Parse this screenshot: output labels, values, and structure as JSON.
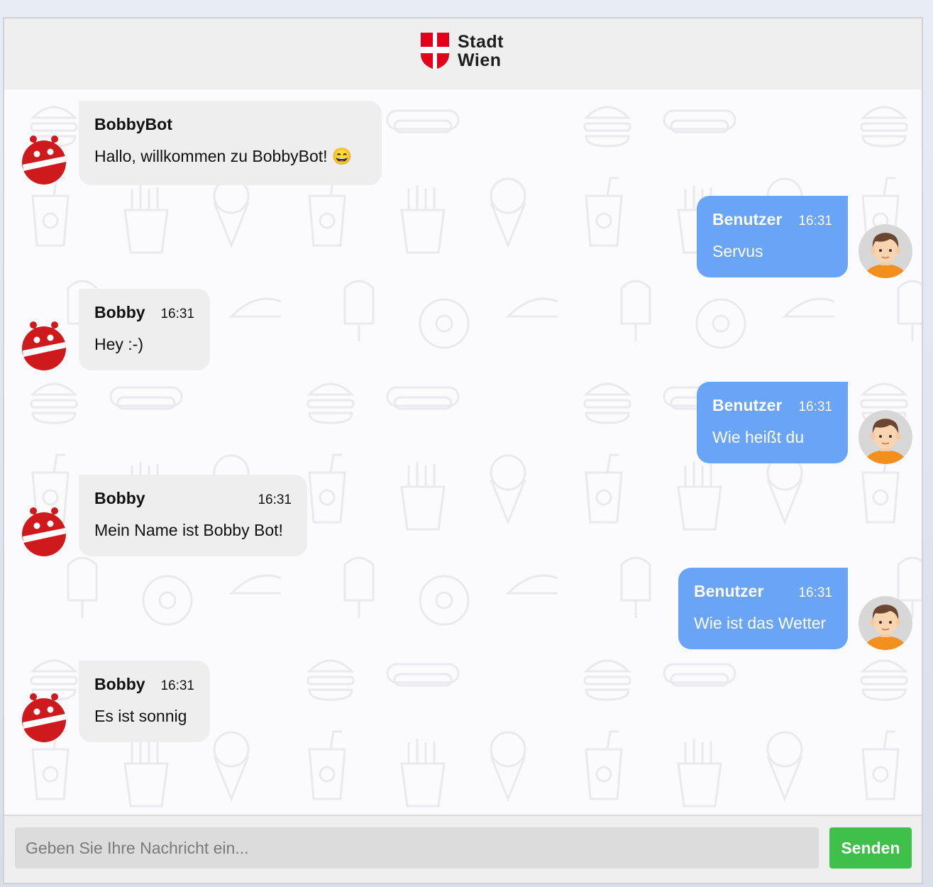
{
  "header": {
    "logo_line1": "Stadt",
    "logo_line2": "Wien"
  },
  "messages": [
    {
      "sender": "BobbyBot",
      "time": "",
      "text": "Hallo, willkommen zu BobbyBot! 😄"
    },
    {
      "sender": "Benutzer",
      "time": "16:31",
      "text": "Servus"
    },
    {
      "sender": "Bobby",
      "time": "16:31",
      "text": "Hey :-)"
    },
    {
      "sender": "Benutzer",
      "time": "16:31",
      "text": "Wie heißt du"
    },
    {
      "sender": "Bobby",
      "time": "16:31",
      "text": "Mein Name ist Bobby Bot!"
    },
    {
      "sender": "Benutzer",
      "time": "16:31",
      "text": "Wie ist das Wetter"
    },
    {
      "sender": "Bobby",
      "time": "16:31",
      "text": "Es ist sonnig"
    }
  ],
  "composer": {
    "placeholder": "Geben Sie Ihre Nachricht ein...",
    "send_label": "Senden"
  },
  "colors": {
    "user_bubble": "#6aa4f7",
    "bot_bubble": "#eeeeee",
    "send_button": "#3fc04a",
    "brand_red": "#e2001a"
  },
  "icons": {
    "bot_avatar": "robot-icon",
    "user_avatar": "user-avatar-icon",
    "logo": "vienna-shield-icon"
  }
}
